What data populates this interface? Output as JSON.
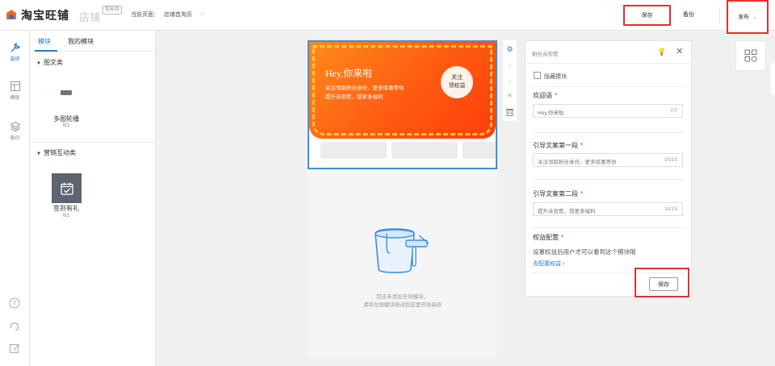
{
  "header": {
    "logo_text": "淘宝旺铺",
    "store_word": "店铺",
    "edition_badge": "智能版",
    "current_page_label": "当前页面：",
    "current_page_value": "店铺首淘页",
    "save_label": "保存",
    "backup_label": "备份",
    "publish_label": "发布"
  },
  "rail": {
    "items": [
      {
        "label": "装修",
        "icon": "wrench-icon",
        "active": true
      },
      {
        "label": "模板",
        "icon": "template-icon",
        "active": false
      },
      {
        "label": "备份",
        "icon": "layers-icon",
        "active": false
      }
    ],
    "bottom_icons": [
      "help-icon",
      "headset-icon",
      "edit-icon"
    ]
  },
  "module_panel": {
    "tabs": [
      "模块",
      "我的模块"
    ],
    "active_tab": 0,
    "groups": [
      {
        "title": "图文类",
        "modules": [
          {
            "name": "多图轮播",
            "count": "0/1"
          }
        ]
      },
      {
        "title": "营销互动类",
        "modules": [
          {
            "name": "签到有礼",
            "count": "0/1"
          }
        ]
      }
    ]
  },
  "canvas": {
    "banner": {
      "title": "Hey,你来啦",
      "line1": "关注领取粉丝身份，更多惊喜等你",
      "line2": "提升亲密度，想更多福利",
      "follow_line1": "关注",
      "follow_line2": "领权益"
    },
    "empty_line1": "您还未添加任何模块，",
    "empty_line2": "请将左侧模块拖动到这里开始装修"
  },
  "settings": {
    "title": "粉丝亲密度",
    "hide_module_label": "隐藏模块",
    "fields": [
      {
        "label": "欢迎语",
        "value": "Hey,你来啦",
        "count": "7/7"
      },
      {
        "label": "引导文案第一段",
        "value": "关注领取粉丝身份，更多惊喜等你",
        "count": "15/15"
      },
      {
        "label": "引导文案第二段",
        "value": "提升亲密度，想更多福利",
        "count": "11/15"
      }
    ],
    "rights_label": "权益配置",
    "rights_desc": "设置权益后用户才可以看到这个模块哦",
    "rights_link": "去配置权益",
    "save_label": "保存"
  },
  "colors": {
    "accent": "#2a77d6",
    "highlight": "#e0322d",
    "banner": "#ff5a12"
  }
}
